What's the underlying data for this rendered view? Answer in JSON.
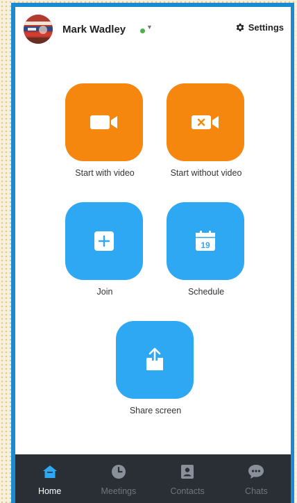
{
  "header": {
    "user_name": "Mark Wadley",
    "status_color": "#4cb14c",
    "settings_label": "Settings"
  },
  "actions": [
    {
      "label": "Start with video",
      "icon": "video-camera-icon",
      "color": "#f5870f"
    },
    {
      "label": "Start without video",
      "icon": "video-off-icon",
      "color": "#f5870f"
    },
    {
      "label": "Join",
      "icon": "plus-icon",
      "color": "#2ea8f2"
    },
    {
      "label": "Schedule",
      "icon": "calendar-icon",
      "color": "#2ea8f2",
      "calendar_day": "19"
    },
    {
      "label": "Share screen",
      "icon": "share-upload-icon",
      "color": "#2ea8f2"
    }
  ],
  "nav": [
    {
      "label": "Home",
      "icon": "home-icon",
      "active": true
    },
    {
      "label": "Meetings",
      "icon": "clock-icon",
      "active": false
    },
    {
      "label": "Contacts",
      "icon": "contact-card-icon",
      "active": false
    },
    {
      "label": "Chats",
      "icon": "chat-bubble-icon",
      "active": false
    }
  ]
}
